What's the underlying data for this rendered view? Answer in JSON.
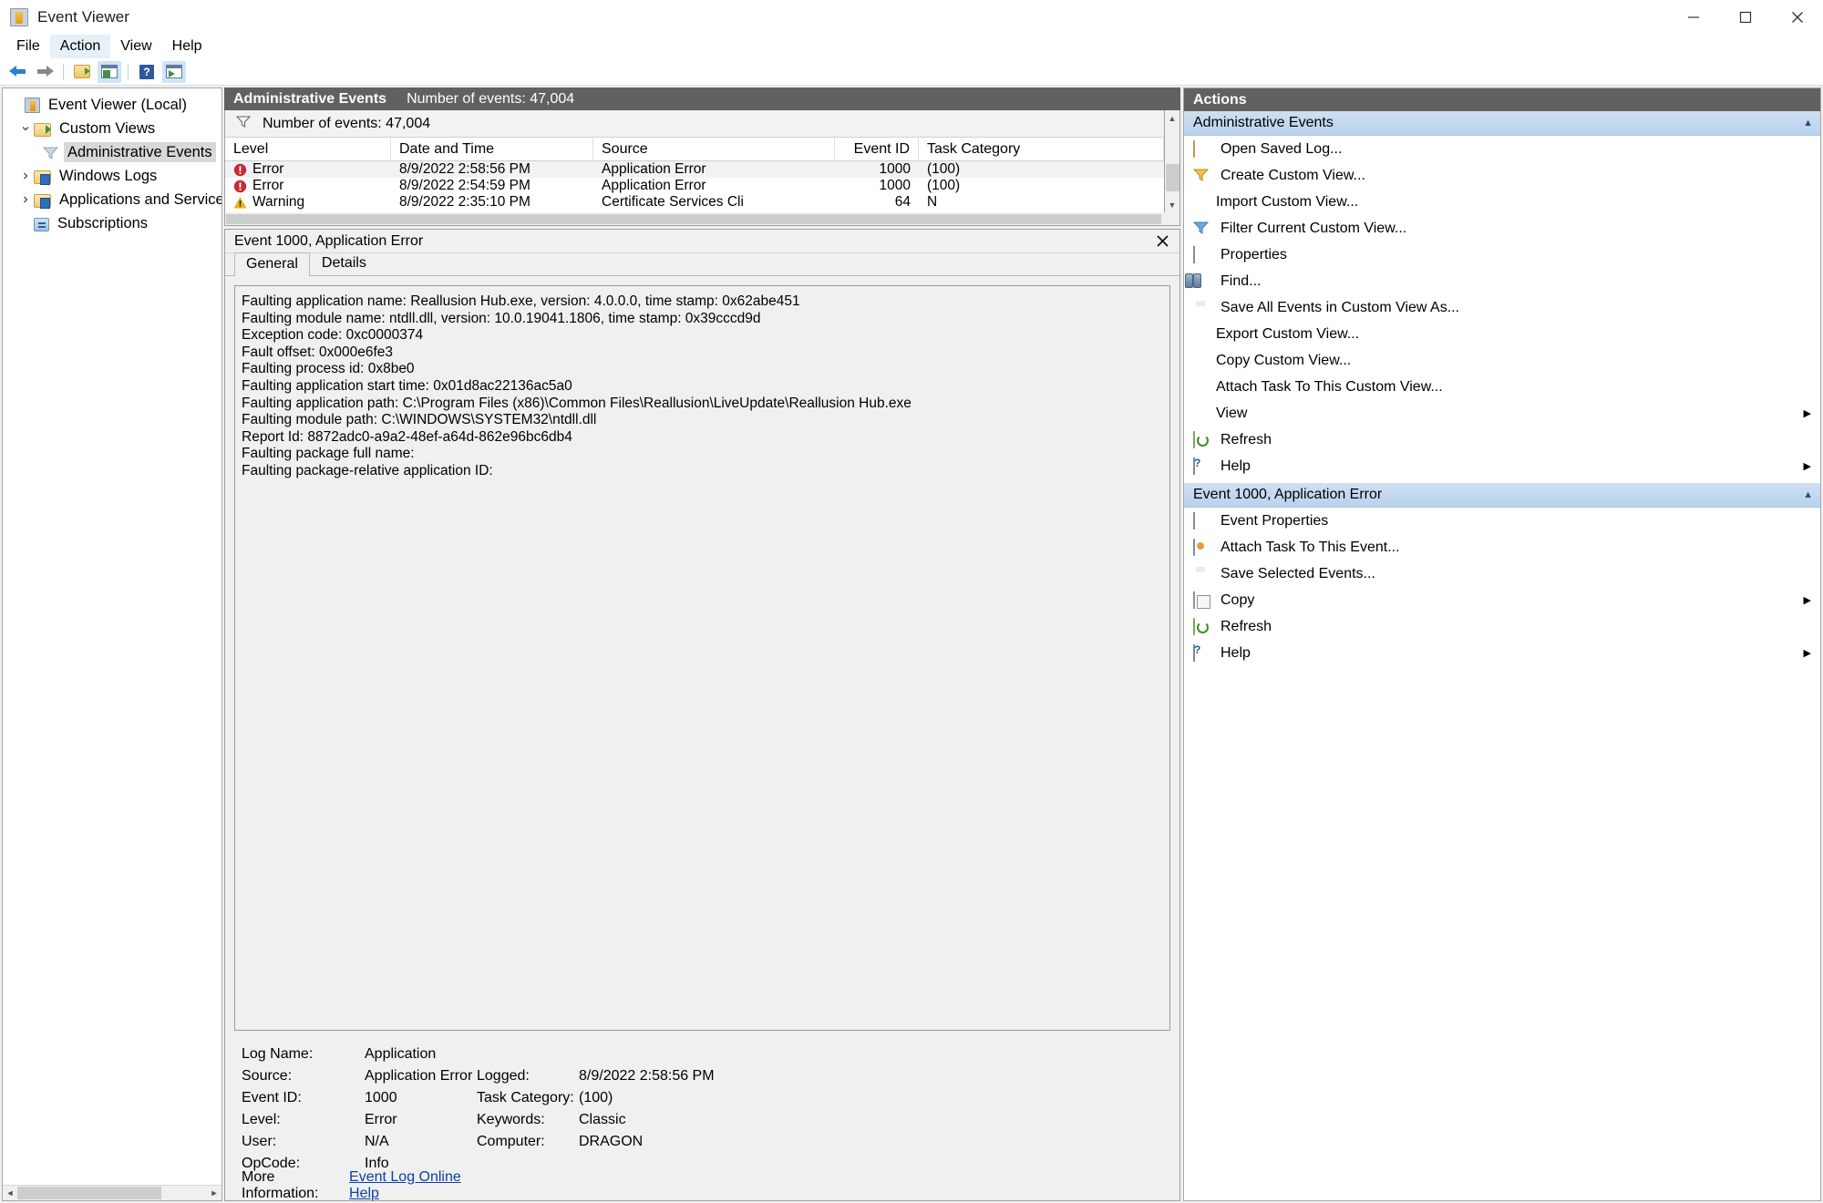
{
  "window": {
    "title": "Event Viewer",
    "icon": "event-viewer-icon",
    "controls": {
      "minimize": "minimize-icon",
      "maximize": "maximize-icon",
      "close": "close-icon"
    }
  },
  "menubar": {
    "items": [
      "File",
      "Action",
      "View",
      "Help"
    ],
    "active": "Action"
  },
  "toolbar": {
    "buttons": [
      {
        "name": "back-button",
        "icon": "back-arrow-icon",
        "selected": false
      },
      {
        "name": "forward-button",
        "icon": "forward-arrow-icon",
        "selected": false
      },
      {
        "name": "show-hide-console-tree-button",
        "icon": "folder-icon",
        "selected": false
      },
      {
        "name": "show-hide-action-pane-button",
        "icon": "pane-icon",
        "selected": true
      },
      {
        "name": "help-button",
        "icon": "help-icon",
        "selected": false
      },
      {
        "name": "show-hide-preview-pane-button",
        "icon": "preview-pane-icon",
        "selected": true
      }
    ]
  },
  "sidebar": {
    "items": [
      {
        "label": "Event Viewer (Local)",
        "icon": "event-viewer-icon",
        "indent": 0,
        "twisty": "none",
        "selected": false
      },
      {
        "label": "Custom Views",
        "icon": "custom-views-folder-icon",
        "indent": 1,
        "twisty": "expanded",
        "selected": false
      },
      {
        "label": "Administrative Events",
        "icon": "funnel-icon",
        "indent": 2,
        "twisty": "none",
        "selected": true
      },
      {
        "label": "Windows Logs",
        "icon": "windows-logs-folder-icon",
        "indent": 1,
        "twisty": "collapsed",
        "selected": false
      },
      {
        "label": "Applications and Services Logs",
        "icon": "app-services-folder-icon",
        "indent": 1,
        "twisty": "collapsed",
        "selected": false
      },
      {
        "label": "Subscriptions",
        "icon": "subscriptions-icon",
        "indent": 1,
        "twisty": "none",
        "selected": false
      }
    ]
  },
  "center": {
    "header_title": "Administrative Events",
    "header_count": "Number of events: 47,004",
    "filter_bar_text": "Number of events: 47,004",
    "columns": [
      "Level",
      "Date and Time",
      "Source",
      "Event ID",
      "Task Category"
    ],
    "rows": [
      {
        "level": "Error",
        "level_icon": "error-icon",
        "datetime": "8/9/2022 2:58:56 PM",
        "source": "Application Error",
        "event_id": "1000",
        "task_category": "(100)",
        "selected": true
      },
      {
        "level": "Error",
        "level_icon": "error-icon",
        "datetime": "8/9/2022 2:54:59 PM",
        "source": "Application Error",
        "event_id": "1000",
        "task_category": "(100)",
        "selected": false
      },
      {
        "level": "Warning",
        "level_icon": "warning-icon",
        "datetime": "8/9/2022 2:35:10 PM",
        "source": "Certificate Services Cli",
        "event_id": "64",
        "task_category": "N",
        "selected": false
      }
    ]
  },
  "detail": {
    "title": "Event 1000, Application Error",
    "close": "close-icon",
    "tabs": [
      {
        "label": "General",
        "active": true
      },
      {
        "label": "Details",
        "active": false
      }
    ],
    "description_lines": [
      "Faulting application name: Reallusion Hub.exe, version: 4.0.0.0, time stamp: 0x62abe451",
      "Faulting module name: ntdll.dll, version: 10.0.19041.1806, time stamp: 0x39cccd9d",
      "Exception code: 0xc0000374",
      "Fault offset: 0x000e6fe3",
      "Faulting process id: 0x8be0",
      "Faulting application start time: 0x01d8ac22136ac5a0",
      "Faulting application path: C:\\Program Files (x86)\\Common Files\\Reallusion\\LiveUpdate\\Reallusion Hub.exe",
      "Faulting module path: C:\\WINDOWS\\SYSTEM32\\ntdll.dll",
      "Report Id: 8872adc0-a9a2-48ef-a64d-862e96bc6db4",
      "Faulting package full name:",
      "Faulting package-relative application ID:"
    ],
    "meta_left": [
      {
        "label": "Log Name:",
        "value": "Application"
      },
      {
        "label": "Source:",
        "value": "Application Error"
      },
      {
        "label": "Event ID:",
        "value": "1000"
      },
      {
        "label": "Level:",
        "value": "Error"
      },
      {
        "label": "User:",
        "value": "N/A"
      },
      {
        "label": "OpCode:",
        "value": "Info"
      }
    ],
    "meta_right": [
      {
        "label": "",
        "value": ""
      },
      {
        "label": "Logged:",
        "value": "8/9/2022 2:58:56 PM"
      },
      {
        "label": "Task Category:",
        "value": "(100)"
      },
      {
        "label": "Keywords:",
        "value": "Classic"
      },
      {
        "label": "Computer:",
        "value": "DRAGON"
      },
      {
        "label": "",
        "value": ""
      }
    ],
    "more_info_label": "More Information:",
    "more_info_link": "Event Log Online Help"
  },
  "actions": {
    "header": "Actions",
    "groups": [
      {
        "title": "Administrative Events",
        "expanded": true,
        "items": [
          {
            "label": "Open Saved Log...",
            "icon": "open-saved-log-icon",
            "submenu": false
          },
          {
            "label": "Create Custom View...",
            "icon": "funnel-icon",
            "submenu": false
          },
          {
            "label": "Import Custom View...",
            "icon": "none",
            "submenu": false
          },
          {
            "label": "Filter Current Custom View...",
            "icon": "funnel-icon",
            "submenu": false
          },
          {
            "label": "Properties",
            "icon": "properties-icon",
            "submenu": false
          },
          {
            "label": "Find...",
            "icon": "binoculars-icon",
            "submenu": false
          },
          {
            "label": "Save All Events in Custom View As...",
            "icon": "save-icon",
            "submenu": false
          },
          {
            "label": "Export Custom View...",
            "icon": "none",
            "submenu": false
          },
          {
            "label": "Copy Custom View...",
            "icon": "none",
            "submenu": false
          },
          {
            "label": "Attach Task To This Custom View...",
            "icon": "none",
            "submenu": false
          },
          {
            "label": "View",
            "icon": "none",
            "submenu": true
          },
          {
            "label": "Refresh",
            "icon": "refresh-icon",
            "submenu": false
          },
          {
            "label": "Help",
            "icon": "help-icon",
            "submenu": true
          }
        ]
      },
      {
        "title": "Event 1000, Application Error",
        "expanded": true,
        "items": [
          {
            "label": "Event Properties",
            "icon": "properties-icon",
            "submenu": false
          },
          {
            "label": "Attach Task To This Event...",
            "icon": "task-icon",
            "submenu": false
          },
          {
            "label": "Save Selected Events...",
            "icon": "save-icon",
            "submenu": false
          },
          {
            "label": "Copy",
            "icon": "copy-icon",
            "submenu": true
          },
          {
            "label": "Refresh",
            "icon": "refresh-icon",
            "submenu": false
          },
          {
            "label": "Help",
            "icon": "help-icon",
            "submenu": true
          }
        ]
      }
    ]
  },
  "colors": {
    "header_bar": "#616161",
    "group_header": "#b9d2ec",
    "error": "#c62b3b",
    "warning": "#e8b21e",
    "link": "#0b3fa8",
    "selection": "#d8d8d8"
  }
}
